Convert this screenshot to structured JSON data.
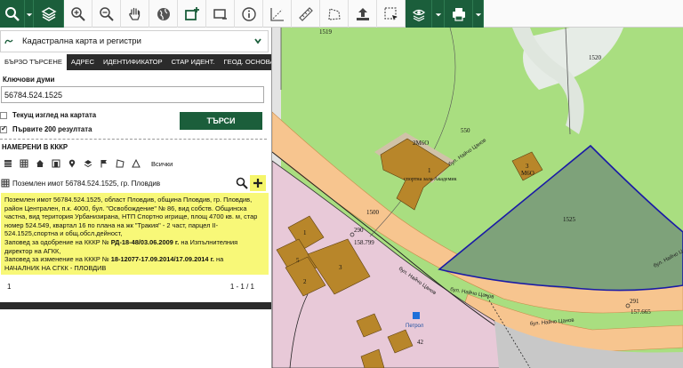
{
  "toolbar": {
    "icons": [
      "search-icon",
      "layers-icon",
      "zoom-in-icon",
      "zoom-out-icon",
      "pan-hand-icon",
      "globe-icon",
      "select-add-icon",
      "select-rect-icon",
      "info-icon",
      "measure-coord-icon",
      "ruler-icon",
      "polygon-measure-icon",
      "upload-icon",
      "select-area-icon",
      "eye-layer-icon",
      "print-icon"
    ]
  },
  "panel": {
    "layer_select_label": "Кадастрална карта и регистри",
    "tabs": [
      "БЪРЗО ТЪРСЕНЕ",
      "АДРЕС",
      "ИДЕНТИФИКАТОР",
      "СТАР ИДЕНТ.",
      "ГЕОД. ОСНОВА"
    ],
    "keywords_label": "Ключови думи",
    "keywords_value": "56784.524.1525",
    "current_view_label": "Текущ изглед на картата",
    "first200_label": "Първите 200 резултата",
    "search_button": "ТЪРСИ",
    "found_title": "НАМЕРЕНИ В КККР",
    "all_label": "Всички",
    "result_title": "Поземлен имот 56784.524.1525, гр. Пловдив",
    "result_text_1": "Поземлен имот 56784.524.1525, област Пловдив, община Пловдив, гр. Пловдив, район Централен, п.к. 4000, бул. \"Освобождение\" № 86, вид собств. Общинска частна, вид територия Урбанизирана, НТП Спортно игрище, площ 4700 кв. м, стар номер 524.549, квартал 16 по плана на жк \"Тракия\" - 2 част, парцел II-524.1525,спортна и общ.обсл.дейност,",
    "result_text_2a": "Заповед за одобрение на КККР № ",
    "result_text_2b": "РД-18-48/03.06.2009 г.",
    "result_text_2c": " на Изпълнителния директор на АГКК,",
    "result_text_3a": "Заповед за изменение на КККР № ",
    "result_text_3b": "18-12077-17.09.2014/17.09.2014 г.",
    "result_text_3c": " на",
    "result_text_4": "НАЧАЛНИК НА СГКК - ПЛОВДИВ",
    "page_num": "1",
    "page_count": "1 - 1 / 1"
  },
  "map": {
    "labels": {
      "p1519": "1519",
      "p1520": "1520",
      "p550": "550",
      "p1500": "1500",
      "p1525": "1525",
      "b2": "2М6О",
      "b1": "1",
      "b1_name": "спортна зала Академик",
      "b3": "3",
      "b3b": "М6О",
      "pt290": "290",
      "pt290v": "158.799",
      "pt291": "291",
      "pt291v": "157.665",
      "num42": "42",
      "petrol": "Петрол",
      "road1": "бул. Найчо Цанов",
      "road2": "бул. Найчо Цанов",
      "road3": "бул. Найчо Цанов",
      "road4": "бул. Найчо Цанов",
      "road5": "бул. Найчо Цанов",
      "num1": "1",
      "num2": "2",
      "num3": "3",
      "num5": "5"
    }
  },
  "colors": {
    "dark_green": "#1b5e3b",
    "highlight_yellow": "#f8f878",
    "grass": "#a9de80",
    "road": "#f7c58f",
    "selected_parcel": "#7ea27a",
    "building": "#b8862a",
    "pink_zone": "#e8c9d8"
  }
}
